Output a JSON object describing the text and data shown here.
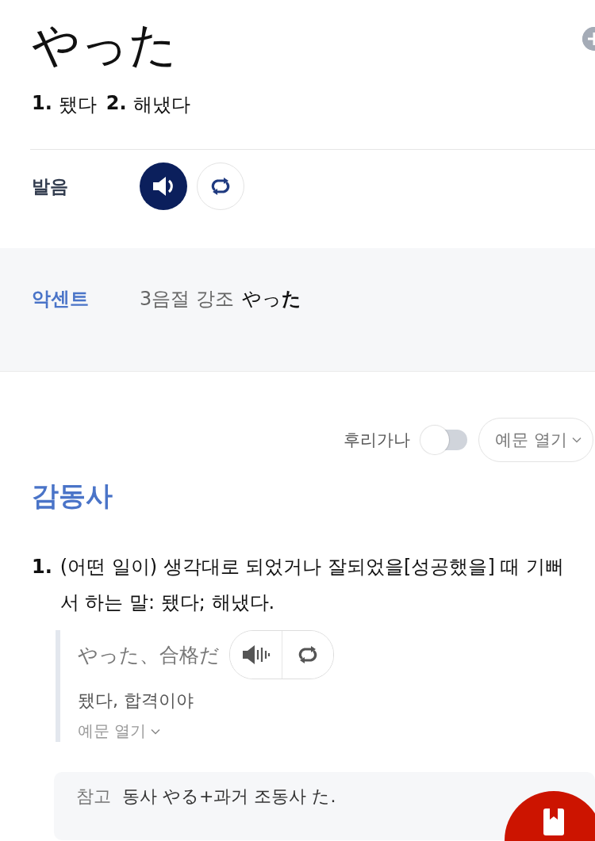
{
  "entry": {
    "headword": "やった",
    "meanings": [
      {
        "number": "1.",
        "text": "됐다"
      },
      {
        "number": "2.",
        "text": "해냈다"
      }
    ]
  },
  "pronunciation": {
    "label": "발음"
  },
  "accent": {
    "label": "악센트",
    "text": "3음절 강조",
    "word": "やっ**た**"
  },
  "toolbar": {
    "furigana_label": "후리가나",
    "furigana_on": false,
    "examples_button": "예문 열기"
  },
  "part_of_speech": "감동사",
  "definitions": [
    {
      "number": "1.",
      "text": "(어떤 일이) 생각대로 되었거나 잘되었을[성공했을] 때 기뻐서 하는 말: 됐다; 해냈다.",
      "examples": [
        {
          "sentence": "やった、合格だ",
          "translation": "됐다, 합격이야",
          "more": "예문 열기"
        }
      ]
    }
  ],
  "note": {
    "label": "참고",
    "text": "동사 やる+과거 조동사 た."
  }
}
